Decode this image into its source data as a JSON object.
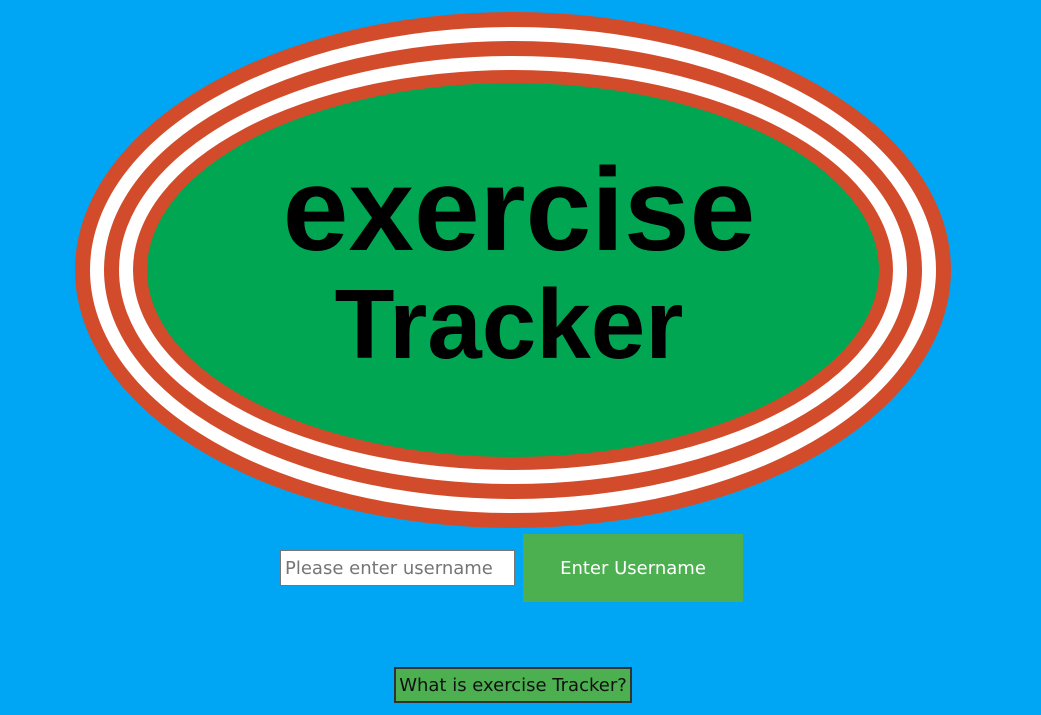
{
  "logo": {
    "line1": "exercise",
    "line2": "Tracker",
    "colors": {
      "outer_ring": "#d24c2b",
      "stripe": "#ffffff",
      "center": "#00a651",
      "text": "#000000"
    }
  },
  "login": {
    "username_value": "",
    "username_placeholder": "Please enter username",
    "enter_button_label": "Enter Username"
  },
  "info_button_label": "What is exercise Tracker?",
  "theme": {
    "background": "#00a6f3",
    "button_green": "#4caf50"
  }
}
